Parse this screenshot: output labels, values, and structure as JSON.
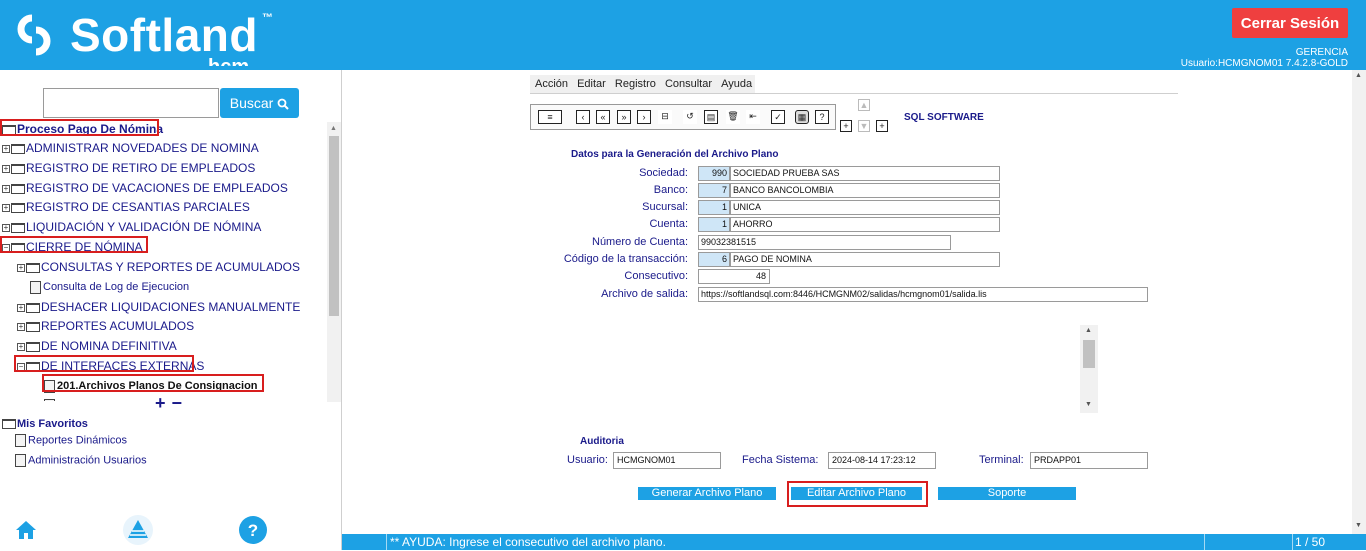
{
  "brand": {
    "name": "Softland",
    "tm": "™",
    "sub": "hcm"
  },
  "header": {
    "logout_label": "Cerrar Sesión",
    "company": "GERENCIA",
    "user_line": "Usuario:HCMGNOM01 7.4.2.8-GOLD"
  },
  "sidebar": {
    "search_placeholder": "",
    "search_label": "Buscar",
    "tree_root": "Proceso Pago De Nómina",
    "items": [
      "ADMINISTRAR NOVEDADES DE NOMINA",
      "REGISTRO DE RETIRO DE EMPLEADOS",
      "REGISTRO DE VACACIONES DE EMPLEADOS",
      "REGISTRO DE CESANTIAS PARCIALES",
      "LIQUIDACIÓN Y VALIDACIÓN DE NÓMINA",
      "CIERRE DE NÓMINA",
      "CONSULTAS Y REPORTES DE ACUMULADOS",
      "Consulta de Log de Ejecucion",
      "DESHACER LIQUIDACIONES MANUALMENTE",
      "REPORTES ACUMULADOS",
      "DE NOMINA DEFINITIVA",
      "DE INTERFACES EXTERNAS",
      "201.Archivos Planos De Consignacion"
    ],
    "favorites_title": "Mis Favoritos",
    "favorites": [
      "Reportes Dinámicos",
      "Administración Usuarios"
    ]
  },
  "menu": [
    "Acción",
    "Editar",
    "Registro",
    "Consultar",
    "Ayuda"
  ],
  "toolbar": {
    "brand": "SQL SOFTWARE"
  },
  "form": {
    "title": "Datos para la Generación del Archivo Plano",
    "sociedad": {
      "label": "Sociedad:",
      "code": "990",
      "name": "SOCIEDAD  PRUEBA SAS"
    },
    "banco": {
      "label": "Banco:",
      "code": "7",
      "name": "BANCO BANCOLOMBIA"
    },
    "sucursal": {
      "label": "Sucursal:",
      "code": "1",
      "name": "UNICA"
    },
    "cuenta": {
      "label": "Cuenta:",
      "code": "1",
      "name": "AHORRO"
    },
    "numero_cuenta": {
      "label": "Número de Cuenta:",
      "value": "99032381515"
    },
    "codigo_transaccion": {
      "label": "Código de la transacción:",
      "code": "6",
      "name": "PAGO DE NOMINA"
    },
    "consecutivo": {
      "label": "Consecutivo:",
      "value": "48"
    },
    "archivo_salida": {
      "label": "Archivo de salida:",
      "value": "https://softlandsql.com:8446/HCMGNM02/salidas/hcmgnom01/salida.lis"
    }
  },
  "audit": {
    "title": "Auditoria",
    "usuario_label": "Usuario:",
    "usuario": "HCMGNOM01",
    "fecha_label": "Fecha Sistema:",
    "fecha": "2024-08-14 17:23:12",
    "terminal_label": "Terminal:",
    "terminal": "PRDAPP01"
  },
  "buttons": {
    "generar": "Generar Archivo Plano",
    "editar": "Editar Archivo Plano",
    "soporte": "Soporte"
  },
  "status": {
    "help": "** AYUDA: Ingrese el consecutivo del archivo plano.",
    "page": "1 / 50"
  },
  "colors": {
    "primary": "#1da1e4",
    "logout": "#ef3f3f",
    "highlight": "#d81e1e",
    "text_navy": "#1a1a8a"
  }
}
